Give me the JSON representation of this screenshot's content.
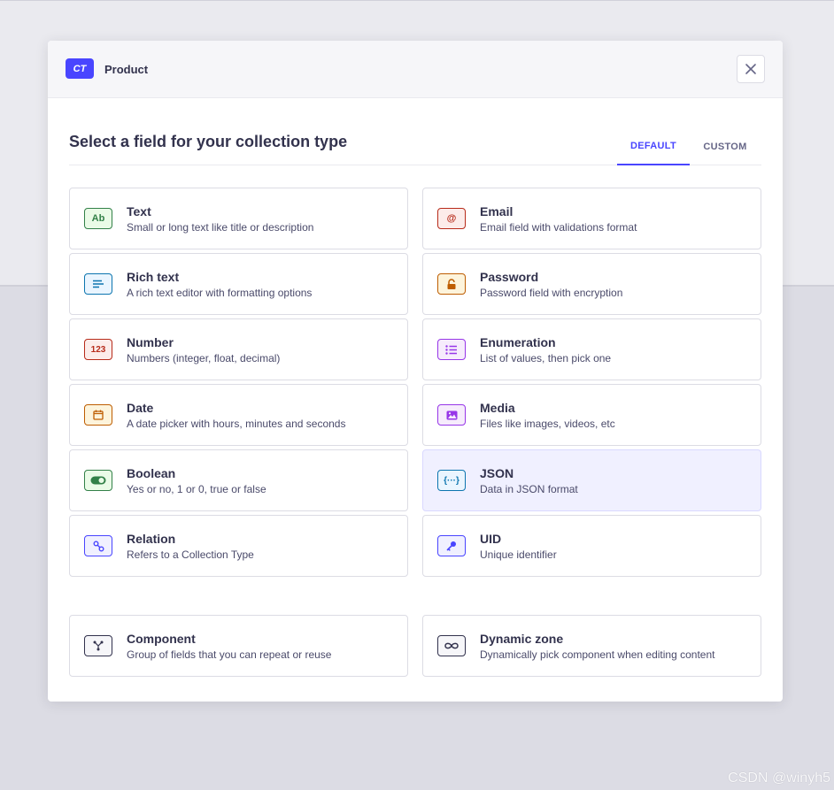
{
  "header": {
    "badge": "CT",
    "title": "Product"
  },
  "section_title": "Select a field for your collection type",
  "tabs": [
    {
      "label": "DEFAULT",
      "selected": true
    },
    {
      "label": "CUSTOM",
      "selected": false
    }
  ],
  "fields": [
    {
      "title": "Text",
      "desc": "Small or long text like title or description",
      "icon": "text-icon",
      "icon_text": "Ab"
    },
    {
      "title": "Email",
      "desc": "Email field with validations format",
      "icon": "email-icon",
      "icon_text": "@"
    },
    {
      "title": "Rich text",
      "desc": "A rich text editor with formatting options",
      "icon": "richtext-icon"
    },
    {
      "title": "Password",
      "desc": "Password field with encryption",
      "icon": "lock-icon"
    },
    {
      "title": "Number",
      "desc": "Numbers (integer, float, decimal)",
      "icon": "number-icon",
      "icon_text": "123"
    },
    {
      "title": "Enumeration",
      "desc": "List of values, then pick one",
      "icon": "list-icon"
    },
    {
      "title": "Date",
      "desc": "A date picker with hours, minutes and seconds",
      "icon": "calendar-icon"
    },
    {
      "title": "Media",
      "desc": "Files like images, videos, etc",
      "icon": "media-icon"
    },
    {
      "title": "Boolean",
      "desc": "Yes or no, 1 or 0, true or false",
      "icon": "toggle-icon"
    },
    {
      "title": "JSON",
      "desc": "Data in JSON format",
      "icon": "json-icon",
      "icon_text": "{···}"
    },
    {
      "title": "Relation",
      "desc": "Refers to a Collection Type",
      "icon": "relation-icon"
    },
    {
      "title": "UID",
      "desc": "Unique identifier",
      "icon": "key-icon"
    }
  ],
  "components": [
    {
      "title": "Component",
      "desc": "Group of fields that you can repeat or reuse",
      "icon": "component-icon"
    },
    {
      "title": "Dynamic zone",
      "desc": "Dynamically pick component when editing content",
      "icon": "infinity-icon"
    }
  ],
  "watermark": "CSDN @winyh5",
  "colors": {
    "accent": "#4945ff",
    "active_card_bg": "#f0f0ff"
  }
}
